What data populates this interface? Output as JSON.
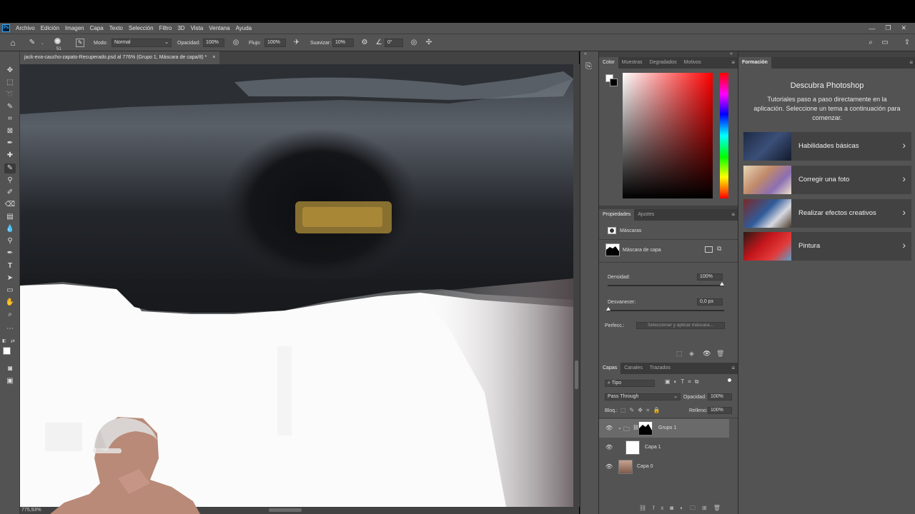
{
  "app": {
    "logo": "Ps"
  },
  "menu": [
    "Archivo",
    "Edición",
    "Imagen",
    "Capa",
    "Texto",
    "Selección",
    "Filtro",
    "3D",
    "Vista",
    "Ventana",
    "Ayuda"
  ],
  "window_controls": {
    "minimize": "—",
    "restore": "❐",
    "close": "✕"
  },
  "options": {
    "brush_size": "51",
    "mode_label": "Modo:",
    "mode_value": "Normal",
    "opacity_label": "Opacidad:",
    "opacity_value": "100%",
    "flow_label": "Flujo:",
    "flow_value": "100%",
    "smooth_label": "Suavizar:",
    "smooth_value": "10%",
    "angle_value": "0°"
  },
  "document": {
    "tab_title": "jack-eva-caucho-zapato-Recuperado.psd al 776% (Grupo 1, Máscara de capa/8) *",
    "tab_close": "×",
    "zoom": "775,93%"
  },
  "color_panel": {
    "tabs": [
      "Color",
      "Muestras",
      "Degradados",
      "Motivos"
    ]
  },
  "properties": {
    "tabs": [
      "Propiedades",
      "Ajustes"
    ],
    "section": "Máscaras",
    "mask_label": "Máscara de capa",
    "density_label": "Densidad:",
    "density_value": "100%",
    "feather_label": "Desvanecer:",
    "feather_value": "0,0 px",
    "refine_label": "Perfecc.:",
    "refine_button": "Seleccionar y aplicar máscara..."
  },
  "layers": {
    "tabs": [
      "Capas",
      "Canales",
      "Trazados"
    ],
    "filter_value": "Tipo",
    "blend_mode": "Pass Through",
    "opacity_label": "Opacidad:",
    "opacity_value": "100%",
    "lock_label": "Bloq.:",
    "fill_label": "Relleno:",
    "fill_value": "100%",
    "items": [
      {
        "name": "Grupo 1"
      },
      {
        "name": "Capa 1"
      },
      {
        "name": "Capa 0"
      }
    ]
  },
  "learn": {
    "tab": "Formación",
    "title": "Descubra Photoshop",
    "description": "Tutoriales paso a paso directamente en la aplicación. Seleccione un tema a continuación para comenzar.",
    "cards": [
      {
        "label": "Habilidades básicas"
      },
      {
        "label": "Corregir una foto"
      },
      {
        "label": "Realizar efectos creativos"
      },
      {
        "label": "Pintura"
      }
    ]
  },
  "colors": {
    "chrome": "#535353",
    "panel_dark": "#424242",
    "accent": "#31a8ff"
  }
}
